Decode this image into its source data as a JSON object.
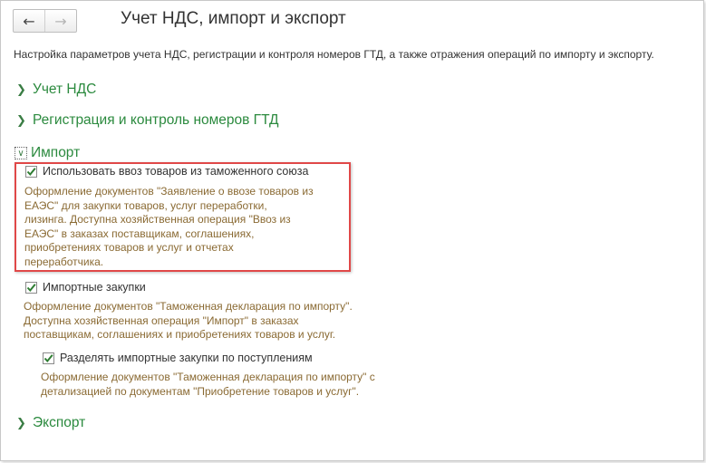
{
  "title": "Учет НДС, импорт и экспорт",
  "nav": {
    "back_icon": "←",
    "forward_icon": "→"
  },
  "description": "Настройка параметров учета НДС, регистрации и контроля номеров ГТД, а также отражения операций по импорту и экспорту.",
  "sections": {
    "vat": {
      "label": "Учет НДС",
      "expanded": false
    },
    "gtd": {
      "label": "Регистрация и контроль номеров ГТД",
      "expanded": false
    },
    "import": {
      "label": "Импорт",
      "expanded": true
    },
    "export": {
      "label": "Экспорт",
      "expanded": false
    }
  },
  "import_options": {
    "customs_union": {
      "label": "Использовать ввоз товаров из таможенного союза",
      "checked": true,
      "hint": [
        "Оформление документов \"Заявление о ввозе товаров из",
        "ЕАЭС\" для закупки товаров, услуг переработки,",
        "лизинга. Доступна хозяйственная операция \"Ввоз из",
        "ЕАЭС\" в заказах поставщикам, соглашениях,",
        "приобретениях товаров и услуг и отчетах",
        "переработчика."
      ]
    },
    "import_purchases": {
      "label": "Импортные закупки",
      "checked": true,
      "hint": [
        "Оформление документов \"Таможенная декларация по импорту\".",
        "Доступна хозяйственная операция \"Импорт\" в заказах",
        "поставщикам, соглашениях и приобретениях товаров и услуг."
      ]
    },
    "split_by_receipts": {
      "label": "Разделять импортные закупки по поступлениям",
      "checked": true,
      "hint": [
        "Оформление документов \"Таможенная декларация по импорту\" с",
        "детализацией по документам \"Приобретение товаров и услуг\"."
      ]
    }
  },
  "colors": {
    "section_green": "#2b8a3e",
    "hint_brown": "#8a6a33",
    "highlight_red": "#e04848",
    "check_green": "#2e7d32"
  }
}
